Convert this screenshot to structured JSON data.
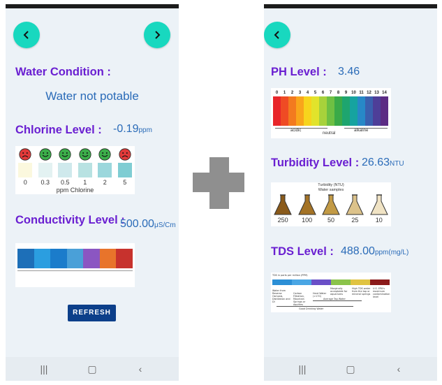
{
  "left_screen": {
    "nav": {
      "back_icon": "chevron-left-icon",
      "forward_icon": "chevron-right-icon"
    },
    "water_condition": {
      "heading": "Water Condition :",
      "value": "Water not potable"
    },
    "chlorine": {
      "heading": "Chlorine Level :",
      "value": "-0.19",
      "unit": "ppm",
      "chart": {
        "faces": [
          "sad",
          "happy",
          "happy",
          "happy",
          "happy",
          "sad"
        ],
        "swatch_colors": [
          "#fbf8de",
          "#e3f2f2",
          "#cfe9ec",
          "#b8e2e2",
          "#9bd7dc",
          "#7fcdd3"
        ],
        "labels": [
          "0",
          "0.3",
          "0.5",
          "1",
          "2",
          "5"
        ],
        "caption": "ppm  Chlorine"
      }
    },
    "conductivity": {
      "heading": "Conductivity Level :",
      "value": "500.00",
      "unit": "μS/Cm",
      "scale_colors": [
        "#1d6fb8",
        "#2b9ee0",
        "#1b7ccb",
        "#4aa0d8",
        "#8b56c2",
        "#e8742b",
        "#c7322d"
      ]
    },
    "refresh_label": "REFRESH"
  },
  "right_screen": {
    "nav": {
      "back_icon": "chevron-left-icon"
    },
    "ph": {
      "heading": "PH Level :",
      "value": "3.46",
      "scale_numbers": [
        "0",
        "1",
        "2",
        "3",
        "4",
        "5",
        "6",
        "7",
        "8",
        "9",
        "10",
        "11",
        "12",
        "13",
        "14"
      ],
      "scale_colors": [
        "#e8262a",
        "#ef4b24",
        "#f37a1f",
        "#f9a51b",
        "#f7d41d",
        "#e2e32b",
        "#a7d23b",
        "#6ec043",
        "#3aaa48",
        "#1ea56f",
        "#16a3a0",
        "#2788c7",
        "#3a5fae",
        "#4e3e98",
        "#5c2c84"
      ],
      "labels": {
        "acidic": "acidic",
        "neutral": "neutral",
        "alkaline": "alkaline"
      }
    },
    "turbidity": {
      "heading": "Turbidity Level :",
      "value": "26.63",
      "unit": "NTU",
      "chart": {
        "title": "Turbidity (NTU)",
        "subtitle": "Water samples",
        "flask_colors": [
          "#8a5a1a",
          "#a47326",
          "#c29a45",
          "#dcc28a",
          "#f0e3c4"
        ],
        "labels": [
          "250",
          "100",
          "50",
          "25",
          "10"
        ]
      }
    },
    "tds": {
      "heading": "TDS Level :",
      "value": "488.00",
      "unit": "ppm(mg/L)",
      "scale_colors": [
        "#2c8fd6",
        "#4aa6e4",
        "#6a4fc7",
        "#8bc34a",
        "#e0c341",
        "#8b1a1a"
      ],
      "legend_title": "TDS in parts per million (PPM)",
      "labels": {
        "left": "Water from Reverse Osmosis, Distillation and DI",
        "hard_water": "Hard Water (>170)",
        "avg_tap": "Average Tap Water",
        "good_drinking": "Good Drinking Water",
        "carbon": "Carbon Filtration, Mountain Springs or Aquifers",
        "marginal": "Marginally acceptable for aquariums",
        "high": "High TDS water from the tap or mineral springs",
        "epa": "U.S. EPA's maximum contamination level"
      }
    }
  }
}
